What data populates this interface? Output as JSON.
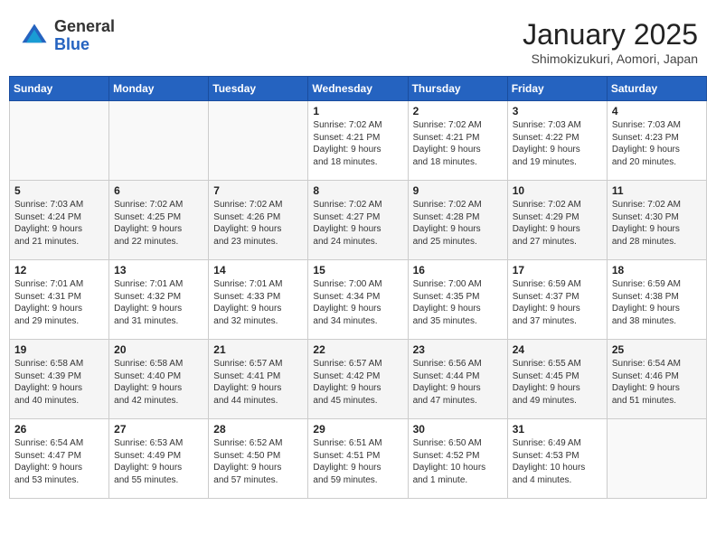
{
  "header": {
    "logo_general": "General",
    "logo_blue": "Blue",
    "title": "January 2025",
    "location": "Shimokizukuri, Aomori, Japan"
  },
  "weekdays": [
    "Sunday",
    "Monday",
    "Tuesday",
    "Wednesday",
    "Thursday",
    "Friday",
    "Saturday"
  ],
  "weeks": [
    [
      {
        "day": "",
        "text": ""
      },
      {
        "day": "",
        "text": ""
      },
      {
        "day": "",
        "text": ""
      },
      {
        "day": "1",
        "text": "Sunrise: 7:02 AM\nSunset: 4:21 PM\nDaylight: 9 hours\nand 18 minutes."
      },
      {
        "day": "2",
        "text": "Sunrise: 7:02 AM\nSunset: 4:21 PM\nDaylight: 9 hours\nand 18 minutes."
      },
      {
        "day": "3",
        "text": "Sunrise: 7:03 AM\nSunset: 4:22 PM\nDaylight: 9 hours\nand 19 minutes."
      },
      {
        "day": "4",
        "text": "Sunrise: 7:03 AM\nSunset: 4:23 PM\nDaylight: 9 hours\nand 20 minutes."
      }
    ],
    [
      {
        "day": "5",
        "text": "Sunrise: 7:03 AM\nSunset: 4:24 PM\nDaylight: 9 hours\nand 21 minutes."
      },
      {
        "day": "6",
        "text": "Sunrise: 7:02 AM\nSunset: 4:25 PM\nDaylight: 9 hours\nand 22 minutes."
      },
      {
        "day": "7",
        "text": "Sunrise: 7:02 AM\nSunset: 4:26 PM\nDaylight: 9 hours\nand 23 minutes."
      },
      {
        "day": "8",
        "text": "Sunrise: 7:02 AM\nSunset: 4:27 PM\nDaylight: 9 hours\nand 24 minutes."
      },
      {
        "day": "9",
        "text": "Sunrise: 7:02 AM\nSunset: 4:28 PM\nDaylight: 9 hours\nand 25 minutes."
      },
      {
        "day": "10",
        "text": "Sunrise: 7:02 AM\nSunset: 4:29 PM\nDaylight: 9 hours\nand 27 minutes."
      },
      {
        "day": "11",
        "text": "Sunrise: 7:02 AM\nSunset: 4:30 PM\nDaylight: 9 hours\nand 28 minutes."
      }
    ],
    [
      {
        "day": "12",
        "text": "Sunrise: 7:01 AM\nSunset: 4:31 PM\nDaylight: 9 hours\nand 29 minutes."
      },
      {
        "day": "13",
        "text": "Sunrise: 7:01 AM\nSunset: 4:32 PM\nDaylight: 9 hours\nand 31 minutes."
      },
      {
        "day": "14",
        "text": "Sunrise: 7:01 AM\nSunset: 4:33 PM\nDaylight: 9 hours\nand 32 minutes."
      },
      {
        "day": "15",
        "text": "Sunrise: 7:00 AM\nSunset: 4:34 PM\nDaylight: 9 hours\nand 34 minutes."
      },
      {
        "day": "16",
        "text": "Sunrise: 7:00 AM\nSunset: 4:35 PM\nDaylight: 9 hours\nand 35 minutes."
      },
      {
        "day": "17",
        "text": "Sunrise: 6:59 AM\nSunset: 4:37 PM\nDaylight: 9 hours\nand 37 minutes."
      },
      {
        "day": "18",
        "text": "Sunrise: 6:59 AM\nSunset: 4:38 PM\nDaylight: 9 hours\nand 38 minutes."
      }
    ],
    [
      {
        "day": "19",
        "text": "Sunrise: 6:58 AM\nSunset: 4:39 PM\nDaylight: 9 hours\nand 40 minutes."
      },
      {
        "day": "20",
        "text": "Sunrise: 6:58 AM\nSunset: 4:40 PM\nDaylight: 9 hours\nand 42 minutes."
      },
      {
        "day": "21",
        "text": "Sunrise: 6:57 AM\nSunset: 4:41 PM\nDaylight: 9 hours\nand 44 minutes."
      },
      {
        "day": "22",
        "text": "Sunrise: 6:57 AM\nSunset: 4:42 PM\nDaylight: 9 hours\nand 45 minutes."
      },
      {
        "day": "23",
        "text": "Sunrise: 6:56 AM\nSunset: 4:44 PM\nDaylight: 9 hours\nand 47 minutes."
      },
      {
        "day": "24",
        "text": "Sunrise: 6:55 AM\nSunset: 4:45 PM\nDaylight: 9 hours\nand 49 minutes."
      },
      {
        "day": "25",
        "text": "Sunrise: 6:54 AM\nSunset: 4:46 PM\nDaylight: 9 hours\nand 51 minutes."
      }
    ],
    [
      {
        "day": "26",
        "text": "Sunrise: 6:54 AM\nSunset: 4:47 PM\nDaylight: 9 hours\nand 53 minutes."
      },
      {
        "day": "27",
        "text": "Sunrise: 6:53 AM\nSunset: 4:49 PM\nDaylight: 9 hours\nand 55 minutes."
      },
      {
        "day": "28",
        "text": "Sunrise: 6:52 AM\nSunset: 4:50 PM\nDaylight: 9 hours\nand 57 minutes."
      },
      {
        "day": "29",
        "text": "Sunrise: 6:51 AM\nSunset: 4:51 PM\nDaylight: 9 hours\nand 59 minutes."
      },
      {
        "day": "30",
        "text": "Sunrise: 6:50 AM\nSunset: 4:52 PM\nDaylight: 10 hours\nand 1 minute."
      },
      {
        "day": "31",
        "text": "Sunrise: 6:49 AM\nSunset: 4:53 PM\nDaylight: 10 hours\nand 4 minutes."
      },
      {
        "day": "",
        "text": ""
      }
    ]
  ]
}
